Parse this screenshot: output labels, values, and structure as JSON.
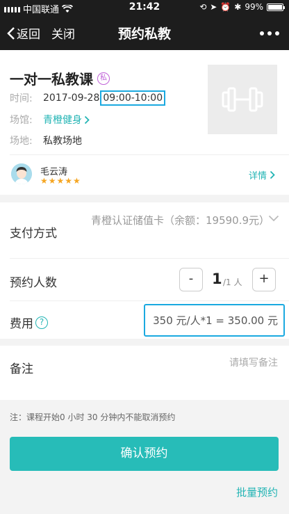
{
  "status_bar": {
    "carrier": "中国联通",
    "time": "21:42",
    "battery_text": "99%",
    "battery_level": 0.99
  },
  "nav": {
    "back_label": "返回",
    "close_label": "关闭",
    "title": "预约私教"
  },
  "course": {
    "title": "一对一私教课",
    "badge": "私",
    "time_label": "时间:",
    "date": "2017-09-28",
    "time_range": "09:00-10:00",
    "venue_label": "场馆:",
    "venue": "青橙健身",
    "place_label": "场地:",
    "place": "私教场地",
    "thumbnail_icon": "dumbbell-icon"
  },
  "coach": {
    "name": "毛云涛",
    "rating": 5,
    "stars": "★★★★★",
    "detail_label": "详情"
  },
  "form": {
    "payment_label": "支付方式",
    "payment_value": "青橙认证储值卡（余额：19590.9元）",
    "count_label": "预约人数",
    "minus": "-",
    "plus": "+",
    "count": "1",
    "count_unit": "/1 人",
    "fee_label": "费用",
    "fee_help": "?",
    "fee_value": "350 元/人*1 = 350.00 元"
  },
  "remark": {
    "label": "备注",
    "placeholder": "请填写备注"
  },
  "note": "注：课程开始0 小时 30 分钟内不能取消预约",
  "confirm_label": "确认预约",
  "batch_label": "批量预约",
  "colors": {
    "accent": "#27bcb8",
    "highlight_border": "#1aa9e0",
    "badge": "#c061d8",
    "star": "#f5a623",
    "bar": "#1d1d1d"
  }
}
